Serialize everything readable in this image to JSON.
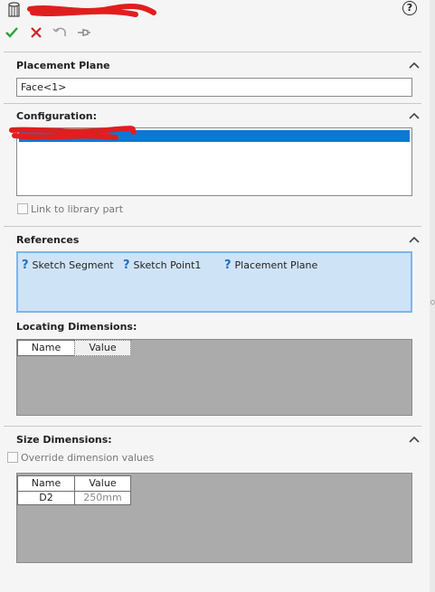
{
  "toolbar": {
    "feature_icon": "hole-wizard-icon",
    "ok_icon": "checkmark-icon",
    "cancel_icon": "close-icon",
    "undo_icon": "undo-icon",
    "pin_icon": "pin-icon",
    "help_icon": "help-icon",
    "help_label": "?"
  },
  "placement_plane": {
    "title": "Placement Plane",
    "value": "Face<1>"
  },
  "configuration": {
    "title": "Configuration:",
    "selected_color": "#0a78d7",
    "link_label": "Link to library part"
  },
  "references": {
    "title": "References",
    "items": [
      {
        "label": "Sketch Segment"
      },
      {
        "label": "Sketch Point1"
      },
      {
        "label": "Placement Plane"
      }
    ],
    "status_glyph": "?"
  },
  "locating_dimensions": {
    "title": "Locating Dimensions:",
    "headers": [
      "Name",
      "Value"
    ]
  },
  "size_dimensions": {
    "title": "Size Dimensions:",
    "override_label": "Override dimension values",
    "headers": [
      "Name",
      "Value"
    ],
    "rows": [
      {
        "name": "D2",
        "value": "250mm"
      }
    ]
  },
  "colors": {
    "ok_green": "#27a33a",
    "cancel_red": "#d32020",
    "selection_blue": "#0a78d7",
    "refs_bg": "#cfe3f7"
  }
}
